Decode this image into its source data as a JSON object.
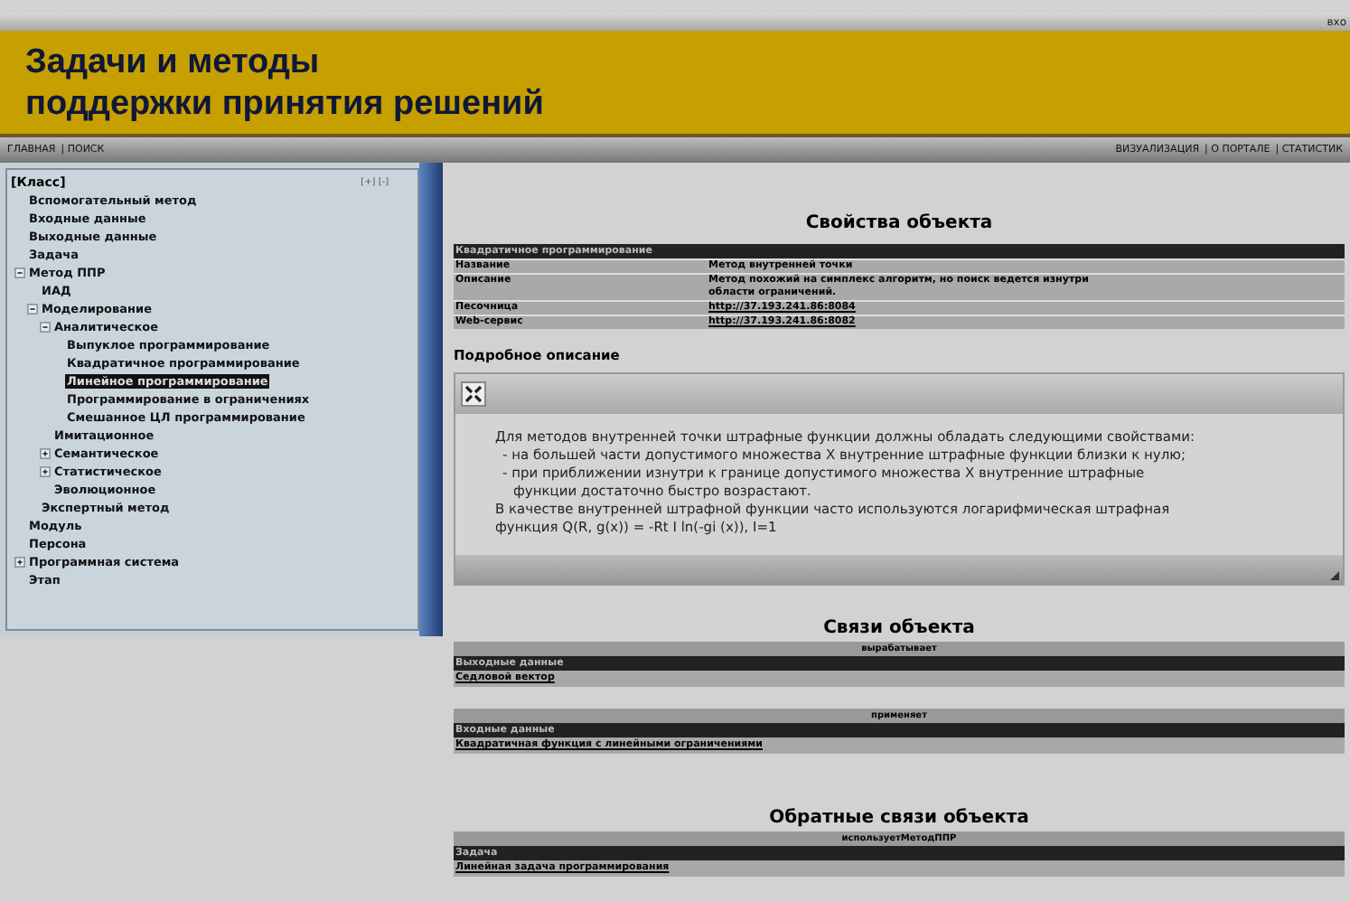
{
  "top_bar": {
    "login": "вхо"
  },
  "header": {
    "title_lines": [
      "Задачи и методы",
      "поддержки принятия решений"
    ]
  },
  "nav_left": [
    "ГЛАВНАЯ",
    "| ПОИСК"
  ],
  "nav_right": [
    "ВИЗУАЛИЗАЦИЯ",
    "| О ПОРТАЛЕ",
    "| СТАТИСТИК"
  ],
  "tree": {
    "root": "[Класс]",
    "tools": "[+] [-]",
    "items": [
      {
        "label": "Вспомогательный метод",
        "selected": false
      },
      {
        "label": "Входные данные",
        "selected": false
      },
      {
        "label": "Выходные данные",
        "selected": false
      },
      {
        "label": "Задача",
        "selected": false
      },
      {
        "label": "Метод ППР",
        "selected": false,
        "expanded": true,
        "children": [
          {
            "label": "ИАД",
            "selected": false
          },
          {
            "label": "Моделирование",
            "selected": false,
            "expanded": true,
            "children": [
              {
                "label": "Аналитическое",
                "selected": false,
                "expanded": true,
                "children": [
                  {
                    "label": "Выпуклое программирование",
                    "selected": false
                  },
                  {
                    "label": "Квадратичное программирование",
                    "selected": false
                  },
                  {
                    "label": "Линейное программирование",
                    "selected": true
                  },
                  {
                    "label": "Программирование в ограничениях",
                    "selected": false
                  },
                  {
                    "label": "Смешанное ЦЛ программирование",
                    "selected": false
                  }
                ]
              },
              {
                "label": "Имитационное",
                "selected": false
              },
              {
                "label": "Семантическое",
                "selected": false,
                "expanded": false
              },
              {
                "label": "Статистическое",
                "selected": false,
                "expanded": false
              },
              {
                "label": "Эволюционное",
                "selected": false
              }
            ]
          },
          {
            "label": "Экспертный метод",
            "selected": false
          }
        ]
      },
      {
        "label": "Модуль",
        "selected": false
      },
      {
        "label": "Персона",
        "selected": false
      },
      {
        "label": "Программная система",
        "selected": false,
        "expanded": false
      },
      {
        "label": "Этап",
        "selected": false
      }
    ]
  },
  "properties": {
    "title": "Свойства объекта",
    "header": "Квадратичное программирование",
    "rows": [
      {
        "name": "Название",
        "value": "Метод внутренней точки",
        "kind": "text"
      },
      {
        "name": "Описание",
        "value": "Метод похожий на симплекс алгоритм, но поиск ведется изнутри области ограничений.",
        "kind": "text"
      },
      {
        "name": "Песочница",
        "value": "http://37.193.241.86:8084",
        "kind": "link"
      },
      {
        "name": "Web-сервис",
        "value": "http://37.193.241.86:8082",
        "kind": "link"
      }
    ]
  },
  "description": {
    "title": "Подробное описание",
    "lines": [
      {
        "text": "Для методов внутренней точки штрафные функции должны обладать следующими свойствами:",
        "kind": "para"
      },
      {
        "text": "- на большей части допустимого множества X внутренние штрафные функции близки к нулю;",
        "kind": "bullet"
      },
      {
        "text": "- при приближении изнутри к границе допустимого множества X внутренние штрафные",
        "kind": "bullet"
      },
      {
        "text": "функции достаточно быстро возрастают.",
        "kind": "cont"
      },
      {
        "text": "В качестве внутренней штрафной функции часто используются логарифмическая штрафная",
        "kind": "para"
      },
      {
        "text": "функция  Q(R, g(x)) = -Rt I ln(-gi (x)), I=1",
        "kind": "para"
      }
    ]
  },
  "relations": {
    "title": "Связи объекта",
    "groups": [
      {
        "relation": "вырабатывает",
        "class": "Выходные данные",
        "links": [
          "Седловой вектор"
        ]
      },
      {
        "relation": "применяет",
        "class": "Входные данные",
        "links": [
          "Квадратичная функция с линейными ограничениями"
        ]
      }
    ]
  },
  "back_relations": {
    "title": "Обратные связи объекта",
    "groups": [
      {
        "relation": "используетМетодППР",
        "class": "Задача",
        "links": [
          "Линейная задача программирования"
        ]
      }
    ]
  }
}
